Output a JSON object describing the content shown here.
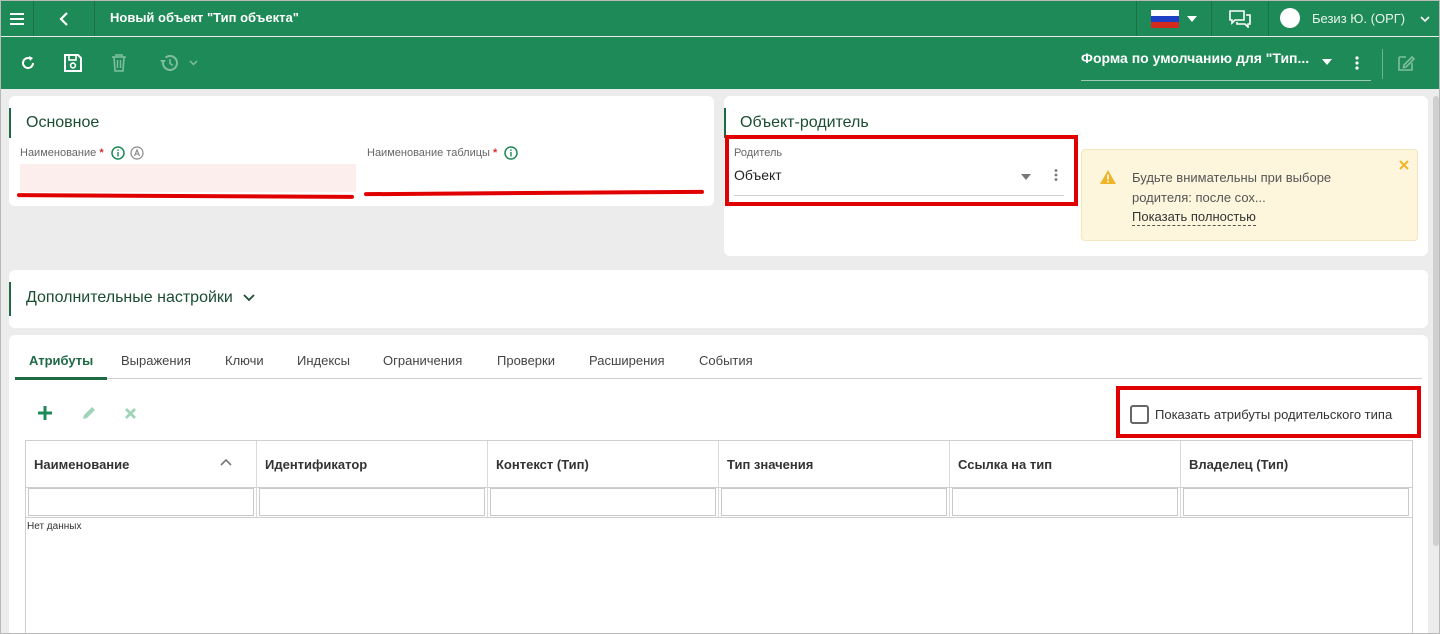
{
  "header": {
    "title": "Новый объект \"Тип объекта\"",
    "user": "Безиз Ю. (ОРГ)"
  },
  "toolbar": {
    "form_selector": "Форма по умолчанию для \"Тип..."
  },
  "main_card": {
    "title": "Основное",
    "name_label": "Наименование",
    "table_name_label": "Наименование таблицы",
    "required_mark": "*"
  },
  "parent_card": {
    "title": "Объект-родитель",
    "parent_label": "Родитель",
    "parent_value": "Объект",
    "warning_text_1": "Будьте внимательны при выборе",
    "warning_text_2": "родителя: после сох...",
    "show_full": "Показать полностью"
  },
  "extra_settings": {
    "title": "Дополнительные настройки"
  },
  "tabs": [
    {
      "label": "Атрибуты"
    },
    {
      "label": "Выражения"
    },
    {
      "label": "Ключи"
    },
    {
      "label": "Индексы"
    },
    {
      "label": "Ограничения"
    },
    {
      "label": "Проверки"
    },
    {
      "label": "Расширения"
    },
    {
      "label": "События"
    }
  ],
  "attributes": {
    "show_parent_attrs": "Показать атрибуты родительского типа",
    "columns": [
      "Наименование",
      "Идентификатор",
      "Контекст (Тип)",
      "Тип значения",
      "Ссылка на тип",
      "Владелец (Тип)"
    ],
    "empty_text": "Нет данных"
  },
  "colors": {
    "brand_green": "#1e8a57",
    "accent_red": "#e10000",
    "warning_bg": "#fdf5dc"
  }
}
